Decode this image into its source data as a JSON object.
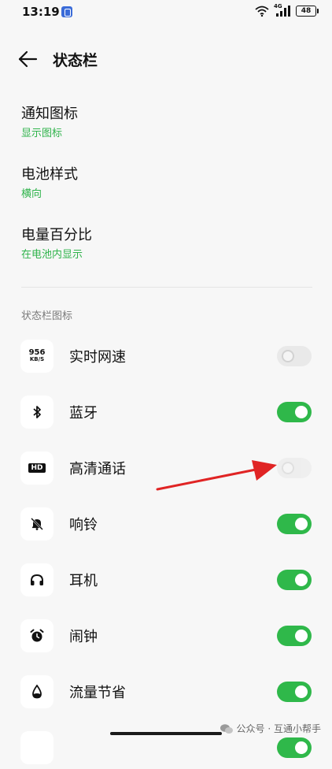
{
  "status": {
    "time": "13:19",
    "network": "4G",
    "battery": "48"
  },
  "header": {
    "title": "状态栏"
  },
  "settings": [
    {
      "title": "通知图标",
      "value": "显示图标"
    },
    {
      "title": "电池样式",
      "value": "横向"
    },
    {
      "title": "电量百分比",
      "value": "在电池内显示"
    }
  ],
  "section": {
    "title": "状态栏图标"
  },
  "icon_items": [
    {
      "label": "实时网速",
      "icon": "network-speed-icon",
      "icon_text_top": "956",
      "icon_text_bottom": "KB/S",
      "enabled": false
    },
    {
      "label": "蓝牙",
      "icon": "bluetooth-icon",
      "enabled": true
    },
    {
      "label": "高清通话",
      "icon": "hd-icon",
      "icon_text": "HD",
      "enabled": false
    },
    {
      "label": "响铃",
      "icon": "bell-muted-icon",
      "enabled": true
    },
    {
      "label": "耳机",
      "icon": "headphones-icon",
      "enabled": true
    },
    {
      "label": "闹钟",
      "icon": "alarm-clock-icon",
      "enabled": true
    },
    {
      "label": "流量节省",
      "icon": "data-saver-icon",
      "enabled": true
    }
  ],
  "watermark": {
    "text": "公众号 · 互通小帮手"
  },
  "colors": {
    "accent": "#2fb84a",
    "subtext": "#2eb34a",
    "arrow": "#e02424"
  }
}
